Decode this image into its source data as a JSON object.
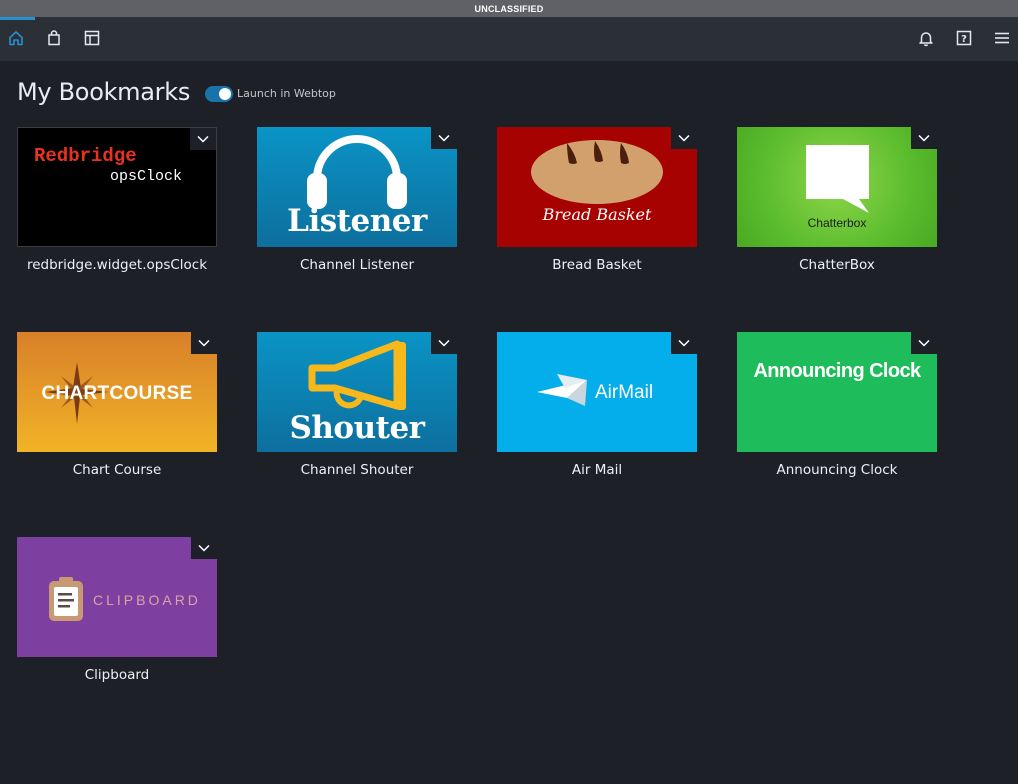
{
  "classification": "UNCLASSIFIED",
  "nav": {
    "left_icons": [
      "home-icon",
      "shopping-bag-icon",
      "layout-icon"
    ],
    "right_icons": [
      "bell-icon",
      "help-icon",
      "menu-icon"
    ],
    "accent": "#2b8fd0"
  },
  "page": {
    "title": "My Bookmarks",
    "toggle_label": "Launch in Webtop",
    "toggle_on": true
  },
  "bookmarks": [
    {
      "label": "redbridge.widget.opsClock",
      "thumb": {
        "line1": "Redbridge",
        "line2": "opsClock"
      }
    },
    {
      "label": "Channel Listener",
      "thumb": {
        "text": "Listener"
      }
    },
    {
      "label": "Bread Basket",
      "thumb": {
        "text": "Bread Basket"
      }
    },
    {
      "label": "ChatterBox",
      "thumb": {
        "text": "Chatterbox"
      }
    },
    {
      "label": "Chart Course",
      "thumb": {
        "text": "CHARTCOURSE"
      }
    },
    {
      "label": "Channel Shouter",
      "thumb": {
        "text": "Shouter"
      }
    },
    {
      "label": "Air Mail",
      "thumb": {
        "text": "AirMail"
      }
    },
    {
      "label": "Announcing Clock",
      "thumb": {
        "text": "Announcing Clock"
      }
    },
    {
      "label": "Clipboard",
      "thumb": {
        "text": "CLIPBOARD"
      }
    }
  ]
}
